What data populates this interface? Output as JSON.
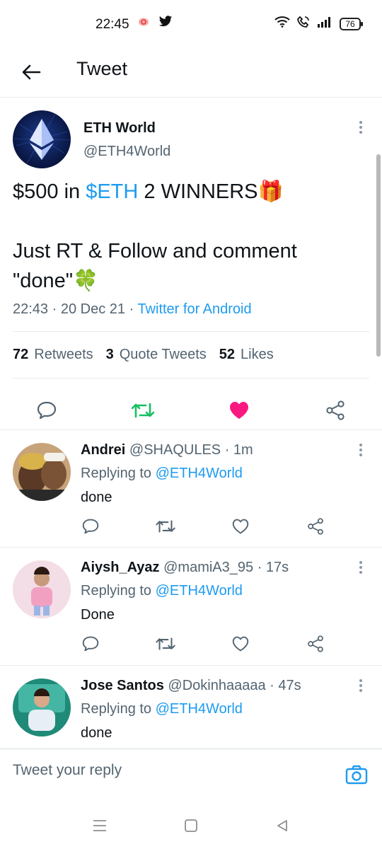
{
  "status_bar": {
    "time": "22:45",
    "battery": "76",
    "icons": [
      "notification-icon",
      "twitter-bird-icon",
      "wifi-icon",
      "call-icon",
      "signal-icon",
      "battery-icon"
    ]
  },
  "header": {
    "title": "Tweet",
    "back_icon": "arrow-left-icon"
  },
  "main_tweet": {
    "author_name": "ETH World",
    "author_handle": "@ETH4World",
    "text_line1_pre": "$500 in ",
    "text_cashtag": "$ETH",
    "text_line1_post": " 2 WINNERS🎁",
    "text_line2": "Just RT & Follow and comment \"done\"🍀",
    "time": "22:43",
    "date": "20 Dec 21",
    "source": "Twitter for Android",
    "retweets_count": "72",
    "retweets_label": "Retweets",
    "quotes_count": "3",
    "quotes_label": "Quote Tweets",
    "likes_count": "52",
    "likes_label": "Likes",
    "retweet_color": "#17bf63",
    "like_color": "#f91880"
  },
  "replies": [
    {
      "name": "Andrei",
      "handle": "@SHAQULES",
      "time": "1m",
      "replying_label": "Replying to",
      "replying_to": "@ETH4World",
      "text": "done"
    },
    {
      "name": "Aiysh_Ayaz",
      "handle": "@mamiA3_95",
      "time": "17s",
      "replying_label": "Replying to",
      "replying_to": "@ETH4World",
      "text": "Done"
    },
    {
      "name": "Jose Santos",
      "handle": "@Dokinhaaaaa",
      "time": "47s",
      "replying_label": "Replying to",
      "replying_to": "@ETH4World",
      "text": "done"
    }
  ],
  "composer": {
    "placeholder": "Tweet your reply"
  },
  "colors": {
    "accent": "#1d9bf0",
    "secondary_text": "#536471",
    "primary_text": "#0f1419"
  }
}
